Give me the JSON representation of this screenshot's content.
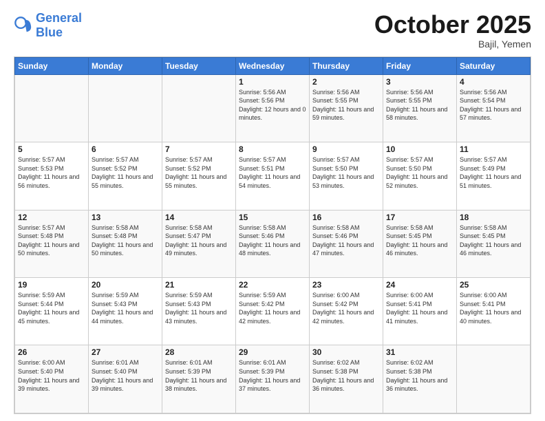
{
  "logo": {
    "text_general": "General",
    "text_blue": "Blue"
  },
  "title": "October 2025",
  "location": "Bajil, Yemen",
  "days_of_week": [
    "Sunday",
    "Monday",
    "Tuesday",
    "Wednesday",
    "Thursday",
    "Friday",
    "Saturday"
  ],
  "weeks": [
    [
      {
        "day": "",
        "sunrise": "",
        "sunset": "",
        "daylight": ""
      },
      {
        "day": "",
        "sunrise": "",
        "sunset": "",
        "daylight": ""
      },
      {
        "day": "",
        "sunrise": "",
        "sunset": "",
        "daylight": ""
      },
      {
        "day": "1",
        "sunrise": "Sunrise: 5:56 AM",
        "sunset": "Sunset: 5:56 PM",
        "daylight": "Daylight: 12 hours and 0 minutes."
      },
      {
        "day": "2",
        "sunrise": "Sunrise: 5:56 AM",
        "sunset": "Sunset: 5:55 PM",
        "daylight": "Daylight: 11 hours and 59 minutes."
      },
      {
        "day": "3",
        "sunrise": "Sunrise: 5:56 AM",
        "sunset": "Sunset: 5:55 PM",
        "daylight": "Daylight: 11 hours and 58 minutes."
      },
      {
        "day": "4",
        "sunrise": "Sunrise: 5:56 AM",
        "sunset": "Sunset: 5:54 PM",
        "daylight": "Daylight: 11 hours and 57 minutes."
      }
    ],
    [
      {
        "day": "5",
        "sunrise": "Sunrise: 5:57 AM",
        "sunset": "Sunset: 5:53 PM",
        "daylight": "Daylight: 11 hours and 56 minutes."
      },
      {
        "day": "6",
        "sunrise": "Sunrise: 5:57 AM",
        "sunset": "Sunset: 5:52 PM",
        "daylight": "Daylight: 11 hours and 55 minutes."
      },
      {
        "day": "7",
        "sunrise": "Sunrise: 5:57 AM",
        "sunset": "Sunset: 5:52 PM",
        "daylight": "Daylight: 11 hours and 55 minutes."
      },
      {
        "day": "8",
        "sunrise": "Sunrise: 5:57 AM",
        "sunset": "Sunset: 5:51 PM",
        "daylight": "Daylight: 11 hours and 54 minutes."
      },
      {
        "day": "9",
        "sunrise": "Sunrise: 5:57 AM",
        "sunset": "Sunset: 5:50 PM",
        "daylight": "Daylight: 11 hours and 53 minutes."
      },
      {
        "day": "10",
        "sunrise": "Sunrise: 5:57 AM",
        "sunset": "Sunset: 5:50 PM",
        "daylight": "Daylight: 11 hours and 52 minutes."
      },
      {
        "day": "11",
        "sunrise": "Sunrise: 5:57 AM",
        "sunset": "Sunset: 5:49 PM",
        "daylight": "Daylight: 11 hours and 51 minutes."
      }
    ],
    [
      {
        "day": "12",
        "sunrise": "Sunrise: 5:57 AM",
        "sunset": "Sunset: 5:48 PM",
        "daylight": "Daylight: 11 hours and 50 minutes."
      },
      {
        "day": "13",
        "sunrise": "Sunrise: 5:58 AM",
        "sunset": "Sunset: 5:48 PM",
        "daylight": "Daylight: 11 hours and 50 minutes."
      },
      {
        "day": "14",
        "sunrise": "Sunrise: 5:58 AM",
        "sunset": "Sunset: 5:47 PM",
        "daylight": "Daylight: 11 hours and 49 minutes."
      },
      {
        "day": "15",
        "sunrise": "Sunrise: 5:58 AM",
        "sunset": "Sunset: 5:46 PM",
        "daylight": "Daylight: 11 hours and 48 minutes."
      },
      {
        "day": "16",
        "sunrise": "Sunrise: 5:58 AM",
        "sunset": "Sunset: 5:46 PM",
        "daylight": "Daylight: 11 hours and 47 minutes."
      },
      {
        "day": "17",
        "sunrise": "Sunrise: 5:58 AM",
        "sunset": "Sunset: 5:45 PM",
        "daylight": "Daylight: 11 hours and 46 minutes."
      },
      {
        "day": "18",
        "sunrise": "Sunrise: 5:58 AM",
        "sunset": "Sunset: 5:45 PM",
        "daylight": "Daylight: 11 hours and 46 minutes."
      }
    ],
    [
      {
        "day": "19",
        "sunrise": "Sunrise: 5:59 AM",
        "sunset": "Sunset: 5:44 PM",
        "daylight": "Daylight: 11 hours and 45 minutes."
      },
      {
        "day": "20",
        "sunrise": "Sunrise: 5:59 AM",
        "sunset": "Sunset: 5:43 PM",
        "daylight": "Daylight: 11 hours and 44 minutes."
      },
      {
        "day": "21",
        "sunrise": "Sunrise: 5:59 AM",
        "sunset": "Sunset: 5:43 PM",
        "daylight": "Daylight: 11 hours and 43 minutes."
      },
      {
        "day": "22",
        "sunrise": "Sunrise: 5:59 AM",
        "sunset": "Sunset: 5:42 PM",
        "daylight": "Daylight: 11 hours and 42 minutes."
      },
      {
        "day": "23",
        "sunrise": "Sunrise: 6:00 AM",
        "sunset": "Sunset: 5:42 PM",
        "daylight": "Daylight: 11 hours and 42 minutes."
      },
      {
        "day": "24",
        "sunrise": "Sunrise: 6:00 AM",
        "sunset": "Sunset: 5:41 PM",
        "daylight": "Daylight: 11 hours and 41 minutes."
      },
      {
        "day": "25",
        "sunrise": "Sunrise: 6:00 AM",
        "sunset": "Sunset: 5:41 PM",
        "daylight": "Daylight: 11 hours and 40 minutes."
      }
    ],
    [
      {
        "day": "26",
        "sunrise": "Sunrise: 6:00 AM",
        "sunset": "Sunset: 5:40 PM",
        "daylight": "Daylight: 11 hours and 39 minutes."
      },
      {
        "day": "27",
        "sunrise": "Sunrise: 6:01 AM",
        "sunset": "Sunset: 5:40 PM",
        "daylight": "Daylight: 11 hours and 39 minutes."
      },
      {
        "day": "28",
        "sunrise": "Sunrise: 6:01 AM",
        "sunset": "Sunset: 5:39 PM",
        "daylight": "Daylight: 11 hours and 38 minutes."
      },
      {
        "day": "29",
        "sunrise": "Sunrise: 6:01 AM",
        "sunset": "Sunset: 5:39 PM",
        "daylight": "Daylight: 11 hours and 37 minutes."
      },
      {
        "day": "30",
        "sunrise": "Sunrise: 6:02 AM",
        "sunset": "Sunset: 5:38 PM",
        "daylight": "Daylight: 11 hours and 36 minutes."
      },
      {
        "day": "31",
        "sunrise": "Sunrise: 6:02 AM",
        "sunset": "Sunset: 5:38 PM",
        "daylight": "Daylight: 11 hours and 36 minutes."
      },
      {
        "day": "",
        "sunrise": "",
        "sunset": "",
        "daylight": ""
      }
    ]
  ]
}
